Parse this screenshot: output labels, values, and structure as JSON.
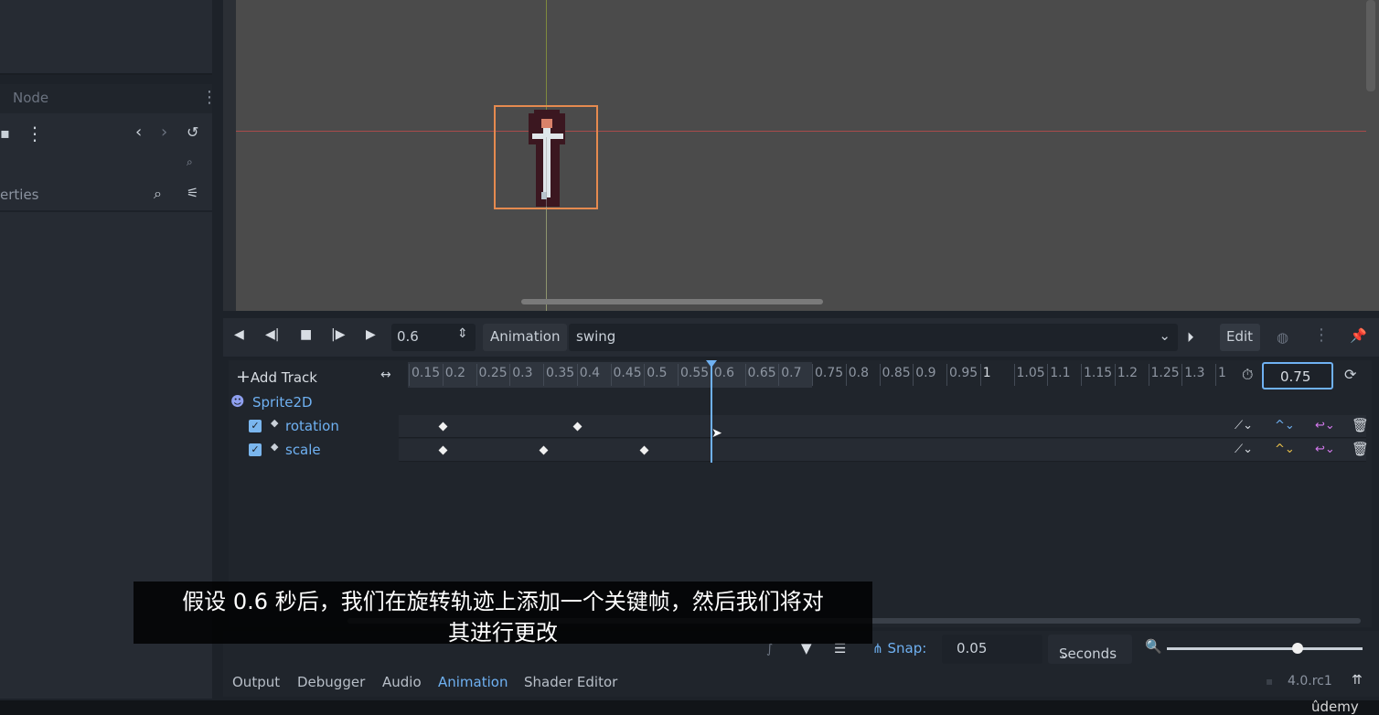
{
  "left_dock": {
    "tab_node": "Node",
    "properties_label": "erties"
  },
  "animation_toolbar": {
    "current_time": "0.6",
    "animation_label": "Animation",
    "animation_name": "swing",
    "edit_label": "Edit"
  },
  "timeline": {
    "add_track_label": "Add Track",
    "ticks": [
      "0.15",
      "0.2",
      "0.25",
      "0.3",
      "0.35",
      "0.4",
      "0.45",
      "0.5",
      "0.55",
      "0.6",
      "0.65",
      "0.7",
      "0.75",
      "0.8",
      "0.85",
      "0.9",
      "0.95",
      "1",
      "1.05",
      "1.1",
      "1.15",
      "1.2",
      "1.25",
      "1.3",
      "1"
    ],
    "length_value": "0.75",
    "node_name": "Sprite2D",
    "tracks": [
      {
        "name": "rotation",
        "keyframe_times": [
          0.2,
          0.4
        ]
      },
      {
        "name": "scale",
        "keyframe_times": [
          0.2,
          0.35,
          0.5
        ]
      }
    ],
    "playhead_time": 0.6
  },
  "bottom_bar": {
    "snap_label": "Snap:",
    "snap_value": "0.05",
    "units": "Seconds",
    "zoom_fraction": 0.67
  },
  "bottom_tabs": [
    "Output",
    "Debugger",
    "Audio",
    "Animation",
    "Shader Editor"
  ],
  "version": "4.0.rc1",
  "watermark": "ûdemy",
  "subtitle": {
    "line1": "假设 0.6 秒后，我们在旋转轨迹上添加一个关键帧，然后我们将对",
    "line2": "其进行更改"
  },
  "colors": {
    "accent": "#6fb1f2",
    "selection": "#e58a4f",
    "panel": "#262b33"
  }
}
